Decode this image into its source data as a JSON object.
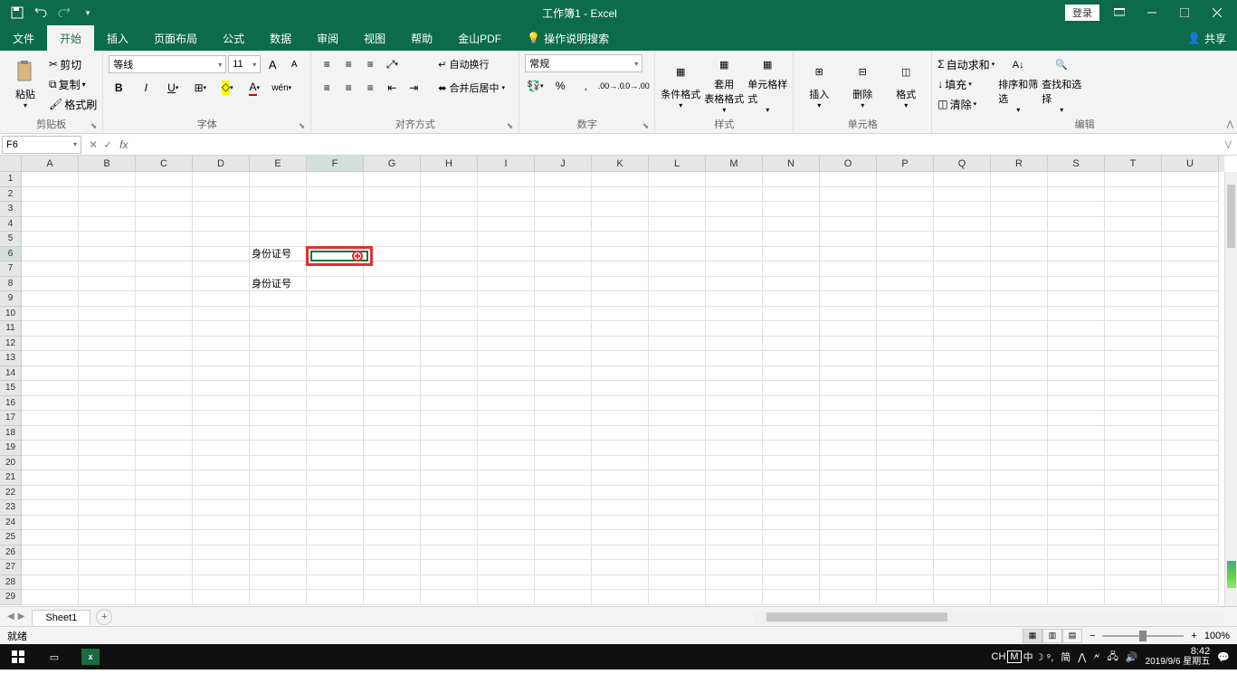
{
  "titlebar": {
    "title": "工作簿1  -  Excel",
    "login": "登录"
  },
  "menu": {
    "file": "文件",
    "home": "开始",
    "insert": "插入",
    "layout": "页面布局",
    "formula": "公式",
    "data": "数据",
    "review": "审阅",
    "view": "视图",
    "help": "帮助",
    "wps": "金山PDF",
    "tellme": "操作说明搜索",
    "share": "共享"
  },
  "ribbon": {
    "clipboard": {
      "label": "剪贴板",
      "paste": "粘贴",
      "cut": "剪切",
      "copy": "复制",
      "painter": "格式刷"
    },
    "font": {
      "label": "字体",
      "name": "等线",
      "size": "11"
    },
    "align": {
      "label": "对齐方式",
      "wrap": "自动换行",
      "merge": "合并后居中"
    },
    "number": {
      "label": "数字",
      "format": "常规"
    },
    "styles": {
      "label": "样式",
      "cond": "条件格式",
      "table": "套用\n表格格式",
      "cell": "单元格样式"
    },
    "cells": {
      "label": "单元格",
      "insert": "插入",
      "delete": "删除",
      "format": "格式"
    },
    "editing": {
      "label": "编辑",
      "sum": "自动求和",
      "fill": "填充",
      "clear": "清除",
      "sort": "排序和筛选",
      "find": "查找和选择"
    }
  },
  "formulabar": {
    "cellref": "F6",
    "formula": ""
  },
  "columns": [
    "A",
    "B",
    "C",
    "D",
    "E",
    "F",
    "G",
    "H",
    "I",
    "J",
    "K",
    "L",
    "M",
    "N",
    "O",
    "P",
    "Q",
    "R",
    "S",
    "T",
    "U"
  ],
  "rows": [
    1,
    2,
    3,
    4,
    5,
    6,
    7,
    8,
    9,
    10,
    11,
    12,
    13,
    14,
    15,
    16,
    17,
    18,
    19,
    20,
    21,
    22,
    23,
    24,
    25,
    26,
    27,
    28,
    29
  ],
  "celldata": {
    "E6": "身份证号",
    "E8": "身份证号"
  },
  "selected": {
    "col": "F",
    "row": 6
  },
  "sheet": {
    "name": "Sheet1"
  },
  "statusbar": {
    "ready": "就绪",
    "zoom": "100%"
  },
  "taskbar": {
    "ime1": "CH",
    "ime2": "M",
    "ime3": "中",
    "ime4": "简",
    "time": "8:42",
    "date": "2019/9/6 星期五"
  }
}
